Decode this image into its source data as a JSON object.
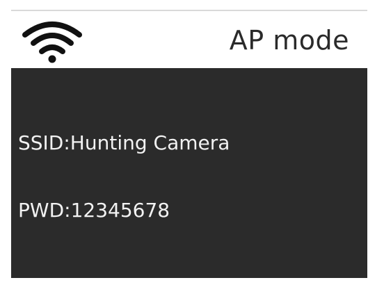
{
  "header": {
    "wifi_icon": "wifi-icon",
    "title": "AP mode"
  },
  "network": {
    "ssid_text": "SSID:Hunting Camera",
    "password_text": "PWD:12345678"
  },
  "colors": {
    "screen_background": "#2b2b2b",
    "header_background": "#ffffff",
    "text_light": "#f2f2f2",
    "text_dark": "#2a2a2a"
  }
}
